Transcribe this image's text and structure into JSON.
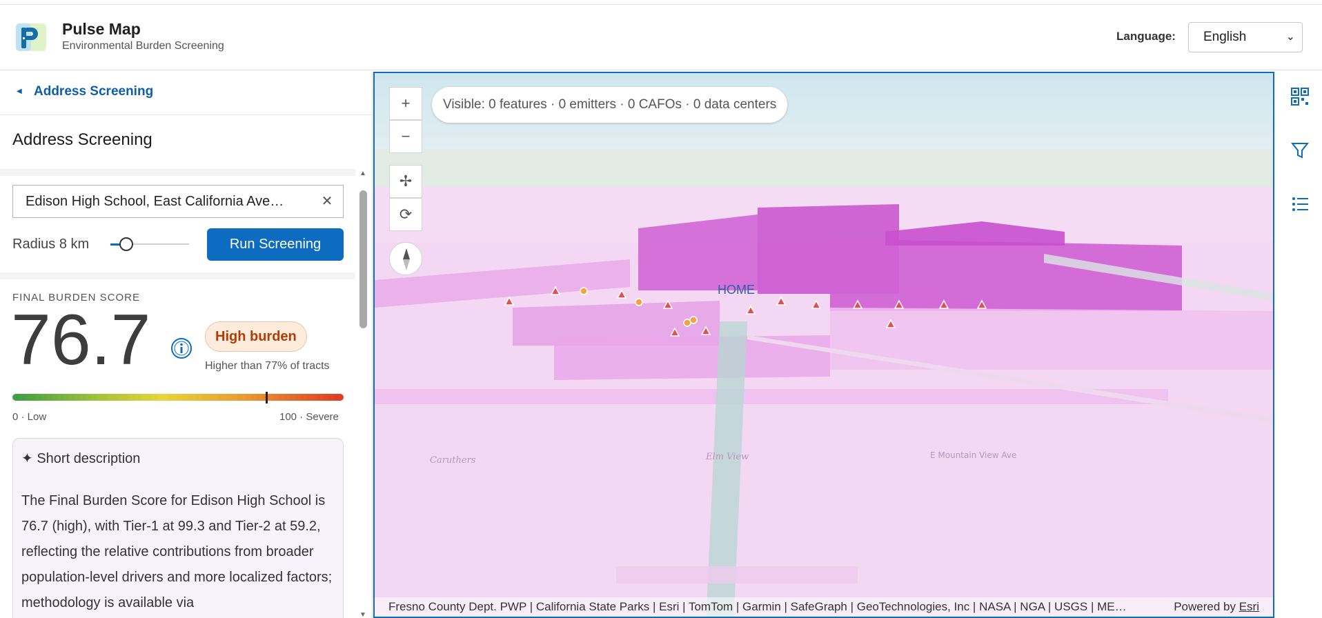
{
  "header": {
    "title": "Pulse Map",
    "subtitle": "Environmental Burden Screening",
    "language_label": "Language:",
    "language_value": "English"
  },
  "sidebar": {
    "breadcrumb": "Address Screening",
    "panel_title": "Address Screening",
    "search_value": "Edison High School, East California Ave…",
    "radius_label": "Radius 8 km",
    "radius_km": 8,
    "run_button": "Run Screening",
    "final_score_label": "FINAL BURDEN SCORE",
    "final_score": "76.7",
    "burden_badge": "High burden",
    "percentile_text": "Higher than 77% of tracts",
    "score_fraction": 0.767,
    "scale_low": "0 · Low",
    "scale_high": "100 · Severe",
    "description_heading": "Short description",
    "description_body": "The Final Burden Score for Edison High School is 76.7 (high), with Tier-1 at 99.3 and Tier-2 at 59.2, reflecting the relative contributions from broader population-level drivers and more localized factors; methodology is available via"
  },
  "map": {
    "visible_summary": "Visible: 0 features · 0 emitters · 0 CAFOs · 0 data centers",
    "zoom_in": "+",
    "zoom_out": "−",
    "home_label": "HOME",
    "place_labels": [
      "Caruthers",
      "Elm View",
      "E Mountain View Ave"
    ],
    "attribution": "Fresno County Dept. PWP | California State Parks | Esri | TomTom | Garmin | SafeGraph | GeoTechnologies, Inc | NASA | NGA | USGS | ME…",
    "powered_by": "Powered by",
    "powered_by_link": "Esri"
  },
  "colors": {
    "accent": "#0d6cc0",
    "badge_text": "#b23d04",
    "map_overlay": "#d96bd9"
  }
}
